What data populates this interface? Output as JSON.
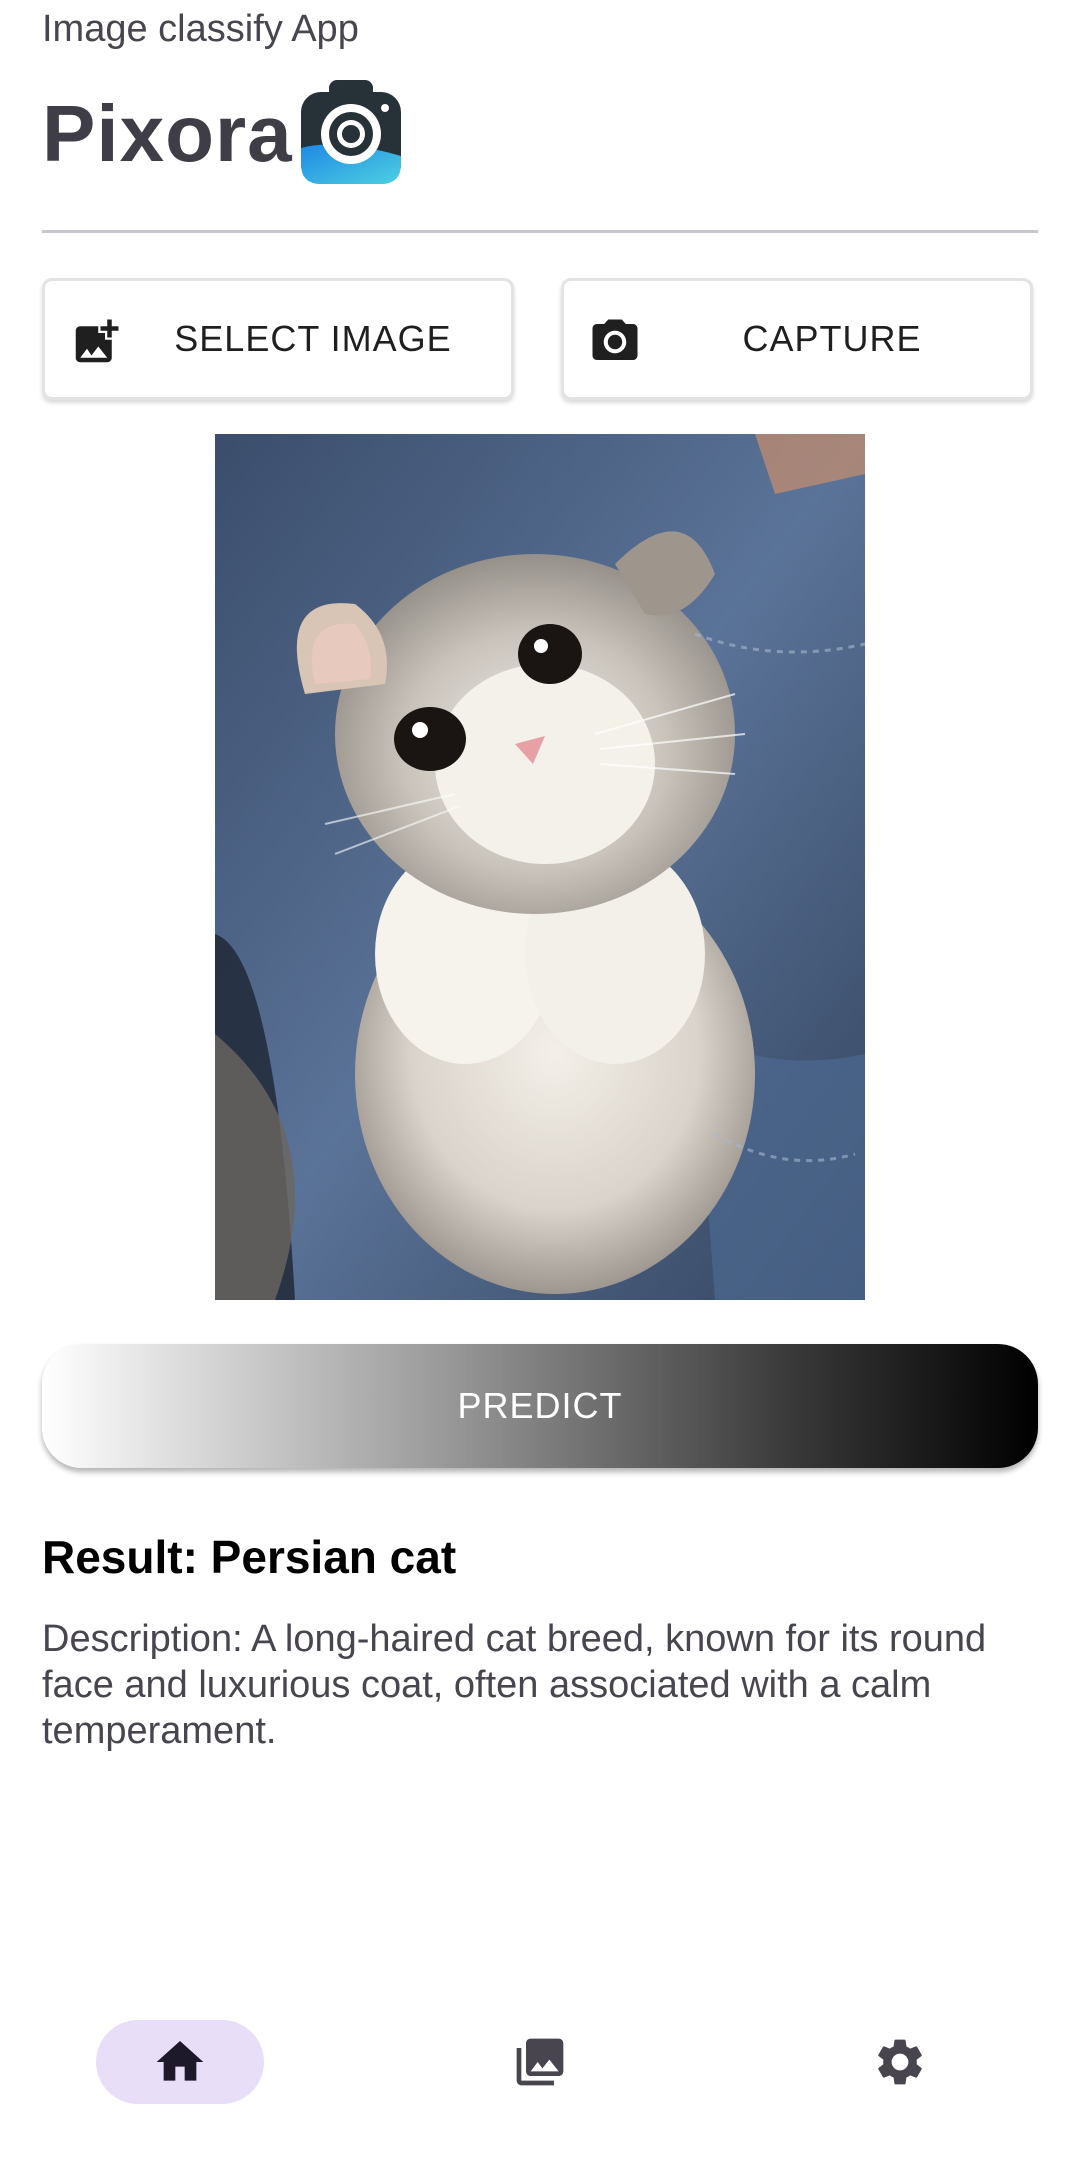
{
  "header": {
    "subtitle": "Image classify App",
    "title": "Pixora",
    "logo_icon": "camera-app-logo-icon"
  },
  "actions": {
    "select_image_label": "SELECT IMAGE",
    "select_image_icon": "add-photo-icon",
    "capture_label": "CAPTURE",
    "capture_icon": "camera-icon"
  },
  "preview": {
    "image": "kitten-photo"
  },
  "predict": {
    "label": "PREDICT"
  },
  "result": {
    "title": "Result: Persian cat",
    "description": "Description: A long-haired cat breed, known for its round face and luxurious coat, often associated with a calm temperament."
  },
  "bottom_nav": {
    "items": [
      {
        "icon": "home-icon",
        "selected": true
      },
      {
        "icon": "gallery-icon",
        "selected": false
      },
      {
        "icon": "settings-icon",
        "selected": false
      }
    ],
    "selected_color": "#e8def8"
  },
  "colors": {
    "title": "#3f3d46",
    "text_secondary": "#49454f",
    "accent_logo": "#29b6f6"
  }
}
